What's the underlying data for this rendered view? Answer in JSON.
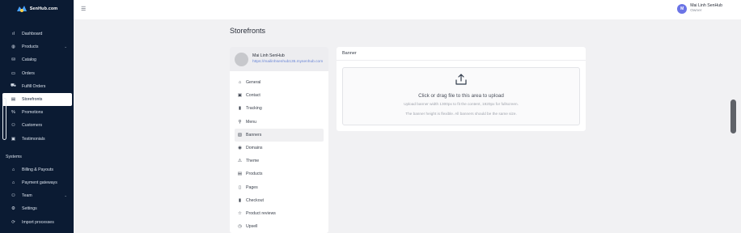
{
  "brand": {
    "name": "SenHub.com",
    "logo_color": "#4aa3ff"
  },
  "sidebar": {
    "items": [
      {
        "label": "Dashboard",
        "icon": "bar-chart-icon",
        "glyph": "ıl"
      },
      {
        "label": "Products",
        "icon": "box-icon",
        "glyph": "◍",
        "has_chevron": true
      },
      {
        "label": "Catalog",
        "icon": "catalog-icon",
        "glyph": "⛁"
      },
      {
        "label": "Orders",
        "icon": "orders-icon",
        "glyph": "▭"
      },
      {
        "label": "Fulfill Orders",
        "icon": "truck-icon",
        "glyph": "⛟"
      },
      {
        "label": "Storefronts",
        "icon": "storefront-icon",
        "glyph": "▤",
        "active": true
      },
      {
        "label": "Promotions",
        "icon": "percent-icon",
        "glyph": "%"
      },
      {
        "label": "Customers",
        "icon": "customers-icon",
        "glyph": "⚇"
      },
      {
        "label": "Testimonials",
        "icon": "testimonial-icon",
        "glyph": "▣"
      }
    ],
    "section_label": "Systems",
    "system_items": [
      {
        "label": "Billing & Payouts",
        "icon": "bank-icon",
        "glyph": "⌂"
      },
      {
        "label": "Payment gateways",
        "icon": "gateway-icon",
        "glyph": "⌂"
      },
      {
        "label": "Team",
        "icon": "team-icon",
        "glyph": "⚇",
        "has_chevron": true
      },
      {
        "label": "Settings",
        "icon": "settings-icon",
        "glyph": "⚙"
      },
      {
        "label": "Import processes",
        "icon": "import-icon",
        "glyph": "⟳"
      }
    ]
  },
  "topbar": {
    "menu_icon": "hamburger-icon",
    "user": {
      "initial": "M",
      "name": "Mai Linh SenHub",
      "role": "Owner",
      "avatar_color": "#6b74e6"
    }
  },
  "page": {
    "title": "Storefronts"
  },
  "store": {
    "name": "Mai Linh SenHub",
    "url": "https://mailinhsenhub135.mysenhub.com",
    "menu": [
      {
        "label": "General",
        "icon": "home-icon",
        "glyph": "⌂"
      },
      {
        "label": "Contact",
        "icon": "contact-icon",
        "glyph": "▣"
      },
      {
        "label": "Tracking",
        "icon": "tracking-icon",
        "glyph": "▮"
      },
      {
        "label": "Menu",
        "icon": "link-icon",
        "glyph": "⚲"
      },
      {
        "label": "Banners",
        "icon": "banner-icon",
        "glyph": "▧",
        "active": true
      },
      {
        "label": "Domains",
        "icon": "globe-icon",
        "glyph": "◉"
      },
      {
        "label": "Theme",
        "icon": "theme-icon",
        "glyph": "⚠"
      },
      {
        "label": "Products",
        "icon": "products-icon",
        "glyph": "▤"
      },
      {
        "label": "Pages",
        "icon": "page-icon",
        "glyph": "▯"
      },
      {
        "label": "Checkout",
        "icon": "checkout-icon",
        "glyph": "▮"
      },
      {
        "label": "Product reviews",
        "icon": "star-icon",
        "glyph": "☆"
      },
      {
        "label": "Upsell",
        "icon": "upsell-icon",
        "glyph": "◷"
      }
    ]
  },
  "banner": {
    "title": "Banner",
    "drop_main": "Click or drag file to this area to upload",
    "drop_hint": "Upload banner width 1300px to fit the content, 1920px for fullscreen.",
    "drop_hint2": "The banner height is flexible. All banners should be the same size.",
    "upload_icon": "upload-icon"
  }
}
